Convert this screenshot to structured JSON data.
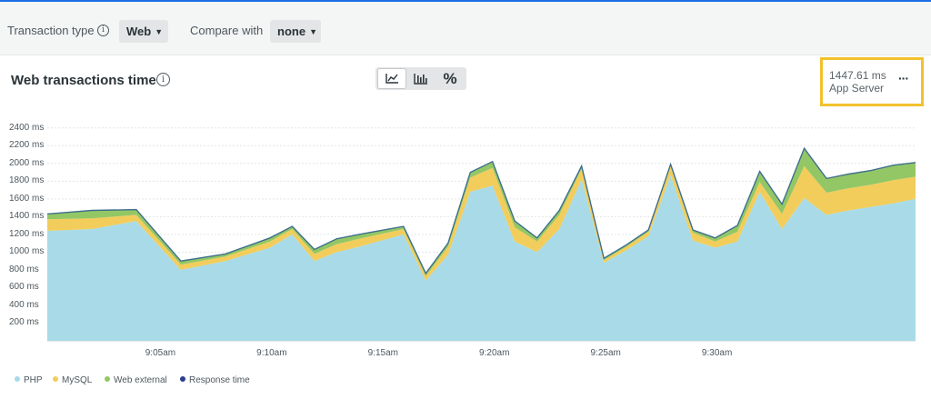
{
  "filters": {
    "transaction_type_label": "Transaction type",
    "transaction_type_value": "Web",
    "compare_label": "Compare with",
    "compare_value": "none"
  },
  "card": {
    "title": "Web transactions time",
    "view_buttons": [
      "line-chart",
      "bar-chart",
      "%"
    ],
    "highlight_value": "1447.61 ms",
    "highlight_label": "App Server",
    "more_label": "···"
  },
  "colors": {
    "PHP": "#a8dbe7",
    "MySQL": "#f2cd5c",
    "Web external": "#93c765",
    "Response time": "#2b3e8c",
    "accent": "#f2c12e"
  },
  "chart_data": {
    "type": "area",
    "stacked": true,
    "x_tick_labels": [
      "9:05am",
      "9:10am",
      "9:15am",
      "9:20am",
      "9:25am",
      "9:30am"
    ],
    "y_tick_labels": [
      "200 ms",
      "400 ms",
      "600 ms",
      "800 ms",
      "1000 ms",
      "1200 ms",
      "1400 ms",
      "1600 ms",
      "1800 ms",
      "2000 ms",
      "2200 ms",
      "2400 ms"
    ],
    "ylim": [
      0,
      2500
    ],
    "grid": true,
    "legend_position": "bottom-left",
    "x_minutes": [
      0,
      2,
      4,
      6,
      8,
      10,
      11,
      12,
      13,
      14,
      16,
      17,
      18,
      19,
      20,
      21,
      22,
      23,
      24,
      25,
      26,
      27,
      28,
      29,
      30,
      31,
      32,
      33,
      34,
      35,
      36,
      37,
      38,
      39
    ],
    "series": [
      {
        "name": "PHP",
        "values": [
          1240,
          1260,
          1350,
          800,
          900,
          1050,
          1200,
          900,
          1000,
          1060,
          1200,
          680,
          970,
          1680,
          1750,
          1120,
          1000,
          1260,
          1820,
          880,
          1020,
          1180,
          1870,
          1130,
          1050,
          1120,
          1680,
          1260,
          1610,
          1420,
          1470,
          1510,
          1550,
          1600
        ]
      },
      {
        "name": "MySQL",
        "values": [
          130,
          120,
          70,
          60,
          50,
          70,
          60,
          80,
          90,
          90,
          60,
          50,
          90,
          160,
          200,
          160,
          120,
          160,
          120,
          30,
          40,
          50,
          100,
          90,
          70,
          110,
          110,
          170,
          360,
          250,
          250,
          250,
          260,
          250
        ]
      },
      {
        "name": "Web external",
        "values": [
          60,
          90,
          60,
          40,
          30,
          40,
          30,
          50,
          60,
          50,
          30,
          30,
          40,
          60,
          70,
          70,
          40,
          50,
          30,
          20,
          20,
          20,
          20,
          30,
          40,
          70,
          120,
          110,
          200,
          160,
          160,
          160,
          170,
          160
        ]
      }
    ],
    "response_time": [
      1430,
      1470,
      1480,
      900,
      980,
      1160,
      1290,
      1030,
      1150,
      1200,
      1290,
      760,
      1100,
      1900,
      2020,
      1350,
      1160,
      1470,
      1970,
      930,
      1080,
      1250,
      1990,
      1250,
      1160,
      1300,
      1910,
      1540,
      2170,
      1830,
      1880,
      1920,
      1980,
      2010
    ]
  },
  "legend": [
    "PHP",
    "MySQL",
    "Web external",
    "Response time"
  ]
}
